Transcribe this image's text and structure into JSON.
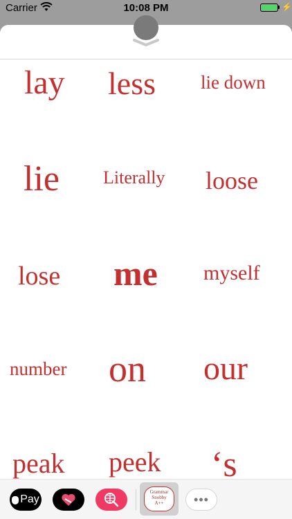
{
  "status_bar": {
    "carrier": "Carrier",
    "time": "10:08 PM",
    "battery_percent": 100,
    "battery_color": "#4cd964"
  },
  "sticker_color": "#c3302f",
  "stickers": [
    "lay",
    "less",
    "lie down",
    "lie",
    "Literally",
    "loose",
    "lose",
    "me",
    "myself",
    "number",
    "on",
    "our",
    "peak",
    "peek",
    "‘s"
  ],
  "drawer": {
    "apple_pay_label": "Pay",
    "grammar_app_label": [
      "Grammar",
      "Snobby",
      "A++"
    ],
    "more_label": "•••",
    "icons": [
      "apple-pay-icon",
      "heart-icon",
      "globe-search-icon",
      "grammar-snobby-app-icon",
      "more-icon"
    ]
  }
}
